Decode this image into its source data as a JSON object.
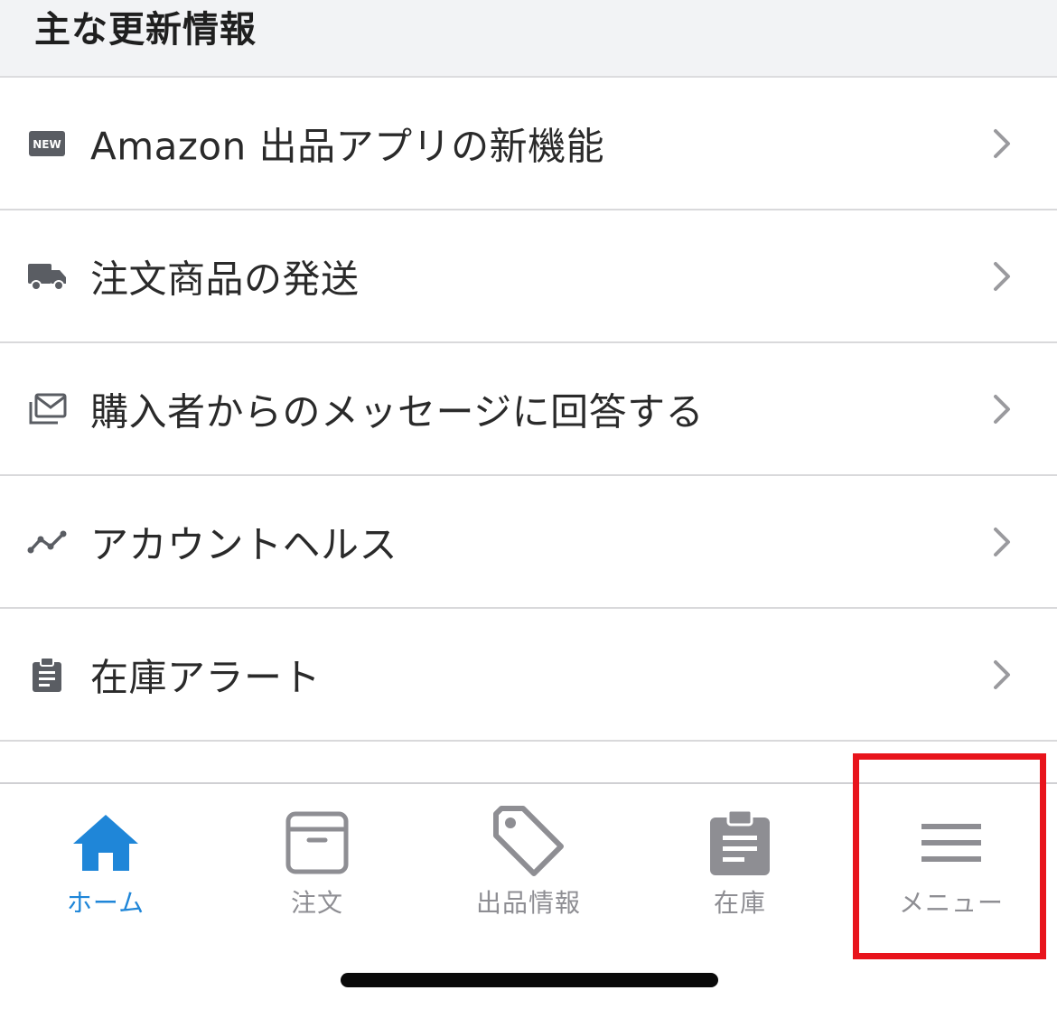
{
  "section": {
    "title": "主な更新情報"
  },
  "list": [
    {
      "label": "Amazon 出品アプリの新機能",
      "icon": "new-badge-icon"
    },
    {
      "label": "注文商品の発送",
      "icon": "truck-icon"
    },
    {
      "label": "購入者からのメッセージに回答する",
      "icon": "messages-icon"
    },
    {
      "label": "アカウントヘルス",
      "icon": "trend-line-icon"
    },
    {
      "label": "在庫アラート",
      "icon": "clipboard-icon"
    }
  ],
  "new_badge_text": "NEW",
  "tabs": [
    {
      "label": "ホーム",
      "icon": "home-icon",
      "active": true
    },
    {
      "label": "注文",
      "icon": "box-icon",
      "active": false
    },
    {
      "label": "出品情報",
      "icon": "tag-icon",
      "active": false
    },
    {
      "label": "在庫",
      "icon": "clipboard-icon",
      "active": false
    },
    {
      "label": "メニュー",
      "icon": "menu-icon",
      "active": false
    }
  ],
  "colors": {
    "active_tab": "#1f86d8",
    "inactive_tab": "#8e8e93",
    "highlight": "#e8141c",
    "header_bg": "#f2f3f5"
  }
}
